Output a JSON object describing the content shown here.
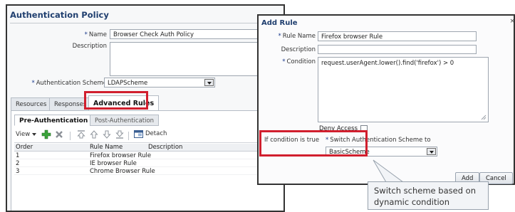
{
  "policy": {
    "title": "Authentication Policy",
    "name_label": "Name",
    "name_value": "Browser Check Auth Policy",
    "description_label": "Description",
    "description_value": "",
    "scheme_label": "Authentication Scheme",
    "scheme_value": "LDAPScheme"
  },
  "tabs": [
    "Resources",
    "Responses",
    "Advanced Rules"
  ],
  "subtabs": [
    "Pre-Authentication",
    "Post-Authentication"
  ],
  "toolbar": {
    "view_label": "View",
    "detach_label": "Detach"
  },
  "table": {
    "columns": [
      "Order",
      "Rule Name",
      "Description"
    ],
    "rows": [
      {
        "order": "1",
        "name": "Firefox browser Rule",
        "description": ""
      },
      {
        "order": "2",
        "name": "IE browser Rule",
        "description": ""
      },
      {
        "order": "3",
        "name": "Chrome Browser Rule",
        "description": ""
      }
    ]
  },
  "dialog": {
    "title": "Add Rule",
    "close": "×",
    "rule_name_label": "Rule Name",
    "rule_name_value": "Firefox browser Rule",
    "description_label": "Description",
    "description_value": "",
    "condition_label": "Condition",
    "condition_value": "request.userAgent.lower().find('firefox') > 0",
    "deny_access_label": "Deny Access",
    "if_true_label": "If condition is true",
    "switch_label": "Switch Authentication Scheme to",
    "switch_value": "BasicScheme",
    "add_label": "Add",
    "cancel_label": "Cancel"
  },
  "callout": "Switch scheme based on dynamic condition",
  "colors": {
    "title": "#203f6f",
    "highlight": "#d11f2e",
    "add_icon": "#3aa33a",
    "delete_icon": "#8a8f96"
  },
  "icons": [
    "chevron-down-icon",
    "add-icon",
    "delete-icon",
    "move-top-icon",
    "move-up-icon",
    "move-down-icon",
    "move-bottom-icon",
    "detach-icon",
    "close-icon",
    "resize-grip-icon"
  ]
}
